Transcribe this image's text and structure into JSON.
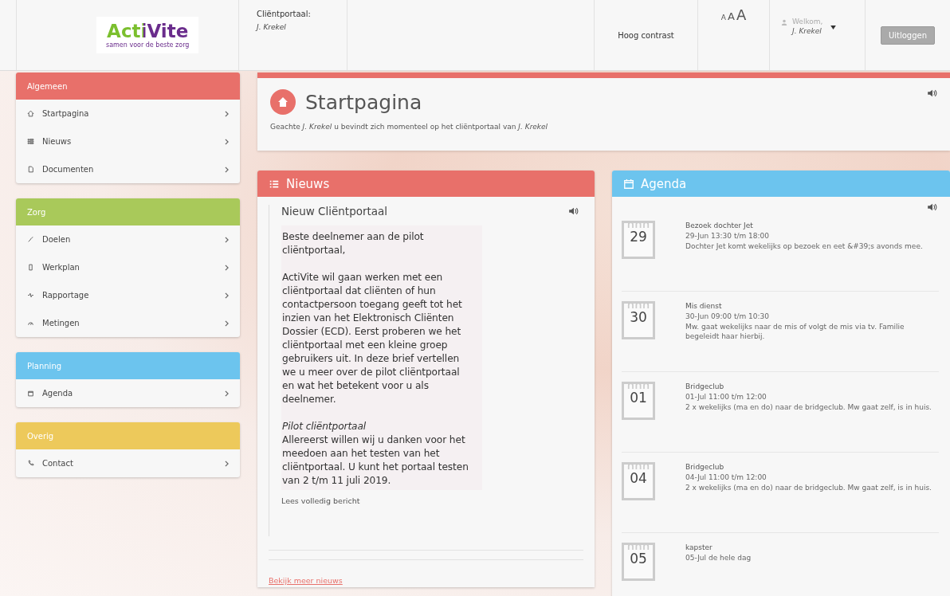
{
  "header": {
    "logo": {
      "wordmark": "ActiVite",
      "tagline": "samen voor de beste zorg"
    },
    "portal": {
      "label": "Cliëntportaal:",
      "name": "J. Krekel"
    },
    "contrast_link": "Hoog contrast",
    "font_sizes": [
      "A",
      "A",
      "A"
    ],
    "user": {
      "greeting": "Welkom,",
      "name": "J. Krekel"
    },
    "logout_button": "Uitloggen"
  },
  "sidebar": {
    "groups": [
      {
        "title": "Algemeen",
        "color": "#e8706a",
        "items": [
          {
            "label": "Startpagina"
          },
          {
            "label": "Nieuws"
          },
          {
            "label": "Documenten"
          }
        ]
      },
      {
        "title": "Zorg",
        "color": "#a9c95a",
        "items": [
          {
            "label": "Doelen"
          },
          {
            "label": "Werkplan"
          },
          {
            "label": "Rapportage"
          },
          {
            "label": "Metingen"
          }
        ]
      },
      {
        "title": "Planning",
        "color": "#6cc4ee",
        "items": [
          {
            "label": "Agenda"
          }
        ]
      },
      {
        "title": "Overig",
        "color": "#edc95b",
        "items": [
          {
            "label": "Contact"
          }
        ]
      }
    ]
  },
  "start_panel": {
    "title": "Startpagina",
    "greeting": "Geachte *J. Krekel* u bevindt zich momenteel op het cliëntportaal van *J. Krekel*"
  },
  "news_panel": {
    "title": "Nieuws",
    "article": {
      "title": "Nieuw Cliëntportaal",
      "paragraphs": [
        "Beste deelnemer aan de pilot cliëntportaal,",
        "ActiVite wil gaan werken met een cliëntportaal dat cliënten of hun contactpersoon toegang geeft tot het inzien van het Elektronisch Cliënten Dossier (ECD). Eerst proberen we het cliëntportaal met een kleine groep gebruikers uit. In deze brief vertellen we u meer over de pilot cliëntportaal en wat het betekent voor u als deelnemer.",
        "*Pilot cliëntportaal*\nAllereerst willen wij u danken voor het meedoen aan het testen van het cliëntportaal. U kunt het portaal testen van 2 t/m 11 juli 2019."
      ],
      "read_more": "Lees volledig bericht"
    },
    "more_link": "Bekijk meer nieuws"
  },
  "agenda_panel": {
    "title": "Agenda",
    "items": [
      {
        "day": "29",
        "title": "Bezoek dochter Jet",
        "time": "29-Jun 13:30 t/m 18:00",
        "description": "Dochter Jet komt wekelijks op bezoek en eet &#39;s avonds mee."
      },
      {
        "day": "30",
        "title": "Mis dienst",
        "time": "30-Jun 09:00 t/m 10:30",
        "description": "Mw. gaat wekelijks naar de mis of volgt de mis via tv. Familie begeleidt haar hierbij."
      },
      {
        "day": "01",
        "title": "Bridgeclub",
        "time": "01-Jul 11:00 t/m 12:00",
        "description": "2 x wekelijks (ma en do) naar de bridgeclub. Mw gaat zelf, is in huis."
      },
      {
        "day": "04",
        "title": "Bridgeclub",
        "time": "04-Jul 11:00 t/m 12:00",
        "description": "2 x wekelijks (ma en do) naar de bridgeclub. Mw gaat zelf, is in huis."
      },
      {
        "day": "05",
        "title": "kapster",
        "time": "05-Jul de hele dag"
      }
    ]
  }
}
